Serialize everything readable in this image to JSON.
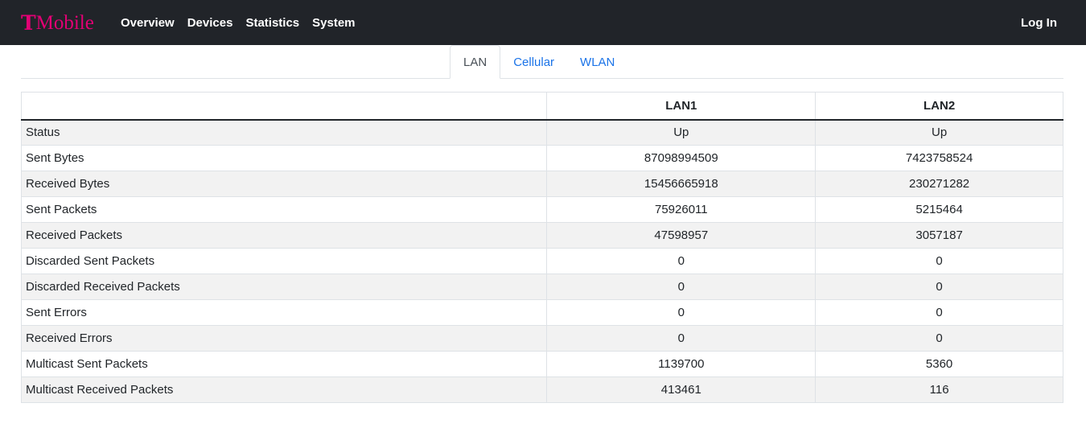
{
  "header": {
    "brand_t": "T",
    "brand_word": "Mobile",
    "nav": [
      "Overview",
      "Devices",
      "Statistics",
      "System"
    ],
    "login_label": "Log In"
  },
  "tabs": [
    {
      "label": "LAN",
      "active": true
    },
    {
      "label": "Cellular",
      "active": false
    },
    {
      "label": "WLAN",
      "active": false
    }
  ],
  "table": {
    "columns": [
      "",
      "LAN1",
      "LAN2"
    ],
    "rows": [
      {
        "label": "Status",
        "lan1": "Up",
        "lan2": "Up"
      },
      {
        "label": "Sent Bytes",
        "lan1": "87098994509",
        "lan2": "7423758524"
      },
      {
        "label": "Received Bytes",
        "lan1": "15456665918",
        "lan2": "230271282"
      },
      {
        "label": "Sent Packets",
        "lan1": "75926011",
        "lan2": "5215464"
      },
      {
        "label": "Received Packets",
        "lan1": "47598957",
        "lan2": "3057187"
      },
      {
        "label": "Discarded Sent Packets",
        "lan1": "0",
        "lan2": "0"
      },
      {
        "label": "Discarded Received Packets",
        "lan1": "0",
        "lan2": "0"
      },
      {
        "label": "Sent Errors",
        "lan1": "0",
        "lan2": "0"
      },
      {
        "label": "Received Errors",
        "lan1": "0",
        "lan2": "0"
      },
      {
        "label": "Multicast Sent Packets",
        "lan1": "1139700",
        "lan2": "5360"
      },
      {
        "label": "Multicast Received Packets",
        "lan1": "413461",
        "lan2": "116"
      }
    ]
  },
  "colors": {
    "brand": "#e20074",
    "navbar": "#212429",
    "link": "#1a73e8"
  }
}
